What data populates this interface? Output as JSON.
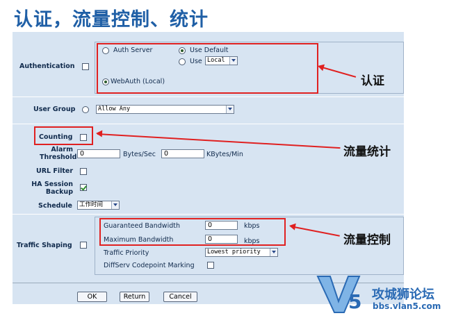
{
  "slide_title": "认证，流量控制、统计",
  "auth": {
    "label": "Authentication",
    "auth_server": "Auth Server",
    "use_default": "Use Default",
    "use": "Use",
    "use_select_value": "Local",
    "webauth": "WebAuth (Local)"
  },
  "user_group": {
    "label": "User Group",
    "value": "Allow Any"
  },
  "counting": {
    "label": "Counting"
  },
  "alarm": {
    "label_line1": "Alarm",
    "label_line2": "Threshold",
    "bytes_value": "0",
    "bytes_unit": "Bytes/Sec",
    "kbytes_value": "0",
    "kbytes_unit": "KBytes/Min"
  },
  "url_filter": {
    "label": "URL Filter"
  },
  "ha": {
    "label_line1": "HA Session",
    "label_line2": "Backup"
  },
  "schedule": {
    "label": "Schedule",
    "value": "工作时间"
  },
  "traffic": {
    "label": "Traffic Shaping",
    "guaranteed_label": "Guaranteed Bandwidth",
    "guaranteed_value": "0",
    "maximum_label": "Maximum Bandwidth",
    "maximum_value": "0",
    "unit": "kbps",
    "priority_label": "Traffic Priority",
    "priority_value": "Lowest priority",
    "diffserv_label": "DiffServ Codepoint Marking"
  },
  "buttons": {
    "ok": "OK",
    "return": "Return",
    "cancel": "Cancel"
  },
  "annotations": {
    "auth": "认证",
    "counting": "流量统计",
    "traffic": "流量控制"
  },
  "watermark": {
    "text": "攻城狮论坛",
    "url": "bbs.vlan5.com"
  },
  "colors": {
    "title": "#1f5fa6",
    "panel": "#d7e4f2",
    "highlight": "#e02020"
  }
}
